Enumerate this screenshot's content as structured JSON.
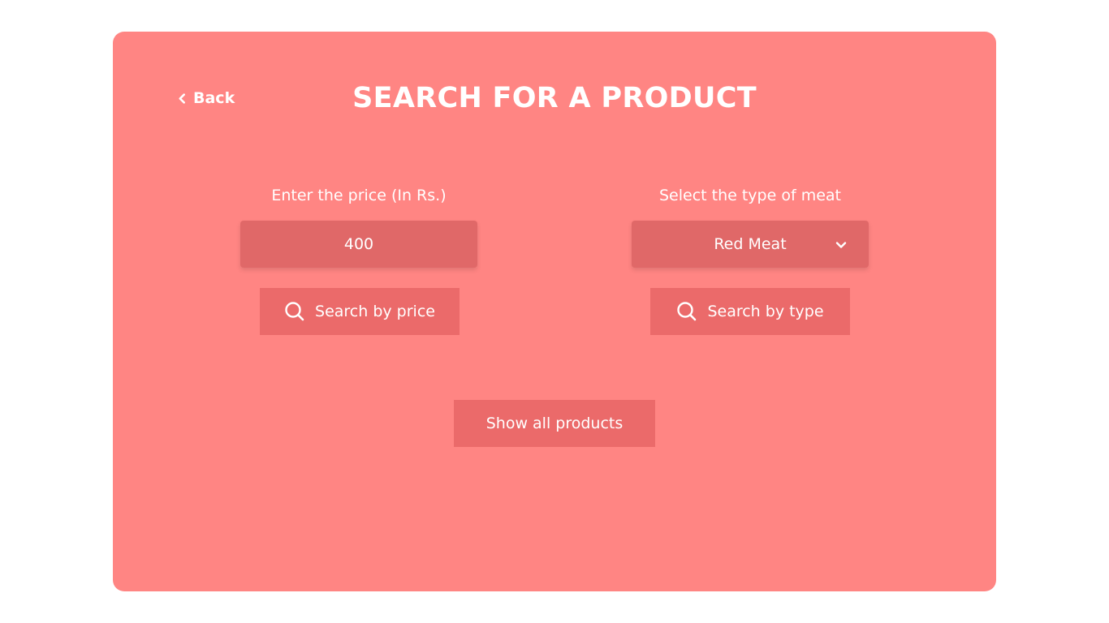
{
  "header": {
    "back_label": "Back",
    "title": "SEARCH FOR A PRODUCT"
  },
  "price_search": {
    "label": "Enter the price (In Rs.)",
    "value": "400",
    "button_label": "Search by price",
    "button_icon": "search-icon"
  },
  "type_search": {
    "label": "Select the type of meat",
    "selected": "Red Meat",
    "dropdown_icon": "chevron-down-icon",
    "button_label": "Search by type",
    "button_icon": "search-icon"
  },
  "show_all": {
    "button_label": "Show all products"
  },
  "colors": {
    "card_background": "#ff8583",
    "field_background": "#e06868",
    "button_background": "#eb6a6a",
    "text": "#ffffff"
  }
}
